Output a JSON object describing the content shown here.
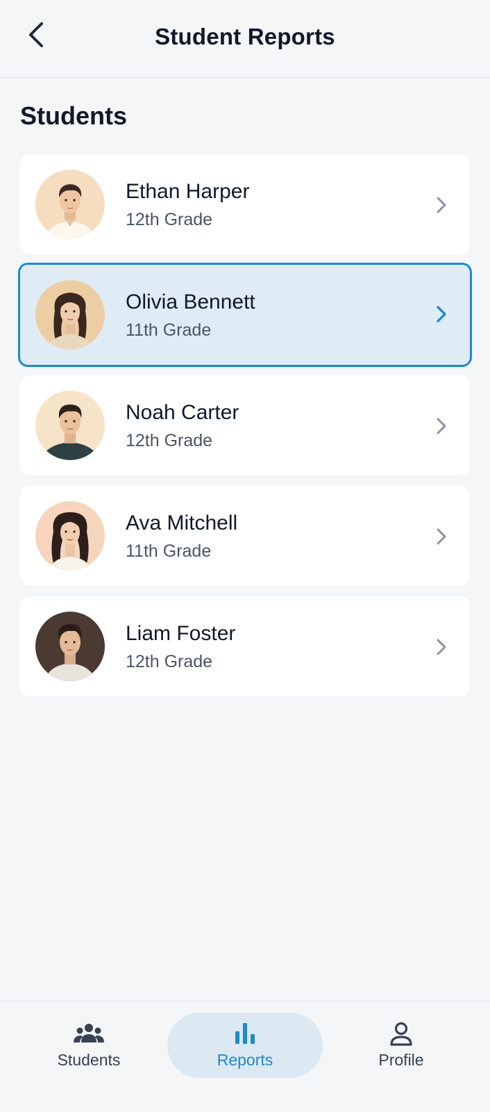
{
  "header": {
    "title": "Student Reports",
    "back_icon": "chevron-left-icon"
  },
  "section": {
    "title": "Students"
  },
  "students": [
    {
      "name": "Ethan Harper",
      "grade": "12th Grade",
      "selected": false
    },
    {
      "name": "Olivia Bennett",
      "grade": "11th Grade",
      "selected": true
    },
    {
      "name": "Noah Carter",
      "grade": "12th Grade",
      "selected": false
    },
    {
      "name": "Ava Mitchell",
      "grade": "11th Grade",
      "selected": false
    },
    {
      "name": "Liam Foster",
      "grade": "12th Grade",
      "selected": false
    }
  ],
  "nav": {
    "items": [
      {
        "label": "Students",
        "icon": "group-icon",
        "active": false
      },
      {
        "label": "Reports",
        "icon": "bar-chart-icon",
        "active": true
      },
      {
        "label": "Profile",
        "icon": "person-icon",
        "active": false
      }
    ]
  },
  "colors": {
    "accent": "#1D8ACB",
    "selected_bg": "#E0ECF5",
    "background": "#F4F6F8",
    "card": "#FFFFFF",
    "text": "#111827",
    "muted": "#4B5563"
  }
}
